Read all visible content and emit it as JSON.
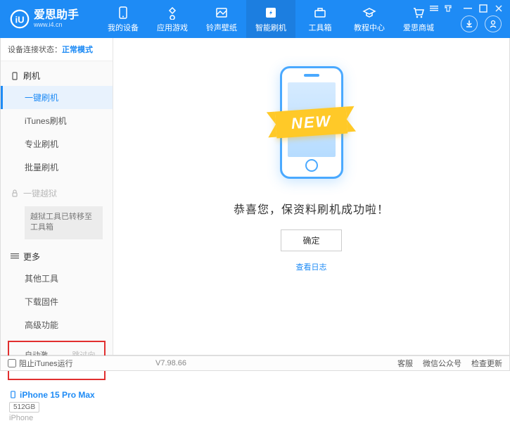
{
  "header": {
    "app_name": "爱思助手",
    "app_sub": "www.i4.cn",
    "nav": [
      {
        "label": "我的设备"
      },
      {
        "label": "应用游戏"
      },
      {
        "label": "铃声壁纸"
      },
      {
        "label": "智能刷机"
      },
      {
        "label": "工具箱"
      },
      {
        "label": "教程中心"
      },
      {
        "label": "爱思商城"
      }
    ]
  },
  "sidebar": {
    "conn_label": "设备连接状态：",
    "conn_status": "正常模式",
    "sections": {
      "flash_title": "刷机",
      "items_flash": [
        "一键刷机",
        "iTunes刷机",
        "专业刷机",
        "批量刷机"
      ],
      "jailbreak_title": "一键越狱",
      "jailbreak_note": "越狱工具已转移至工具箱",
      "more_title": "更多",
      "items_more": [
        "其他工具",
        "下载固件",
        "高级功能"
      ]
    },
    "checks": {
      "auto_activate": "自动激活",
      "skip_guide": "跳过向导"
    },
    "device": {
      "name": "iPhone 15 Pro Max",
      "storage": "512GB",
      "type": "iPhone"
    }
  },
  "main": {
    "ribbon": "NEW",
    "success": "恭喜您，保资料刷机成功啦！",
    "ok": "确定",
    "log": "查看日志"
  },
  "statusbar": {
    "block_itunes": "阻止iTunes运行",
    "version": "V7.98.66",
    "right": [
      "客服",
      "微信公众号",
      "检查更新"
    ]
  }
}
